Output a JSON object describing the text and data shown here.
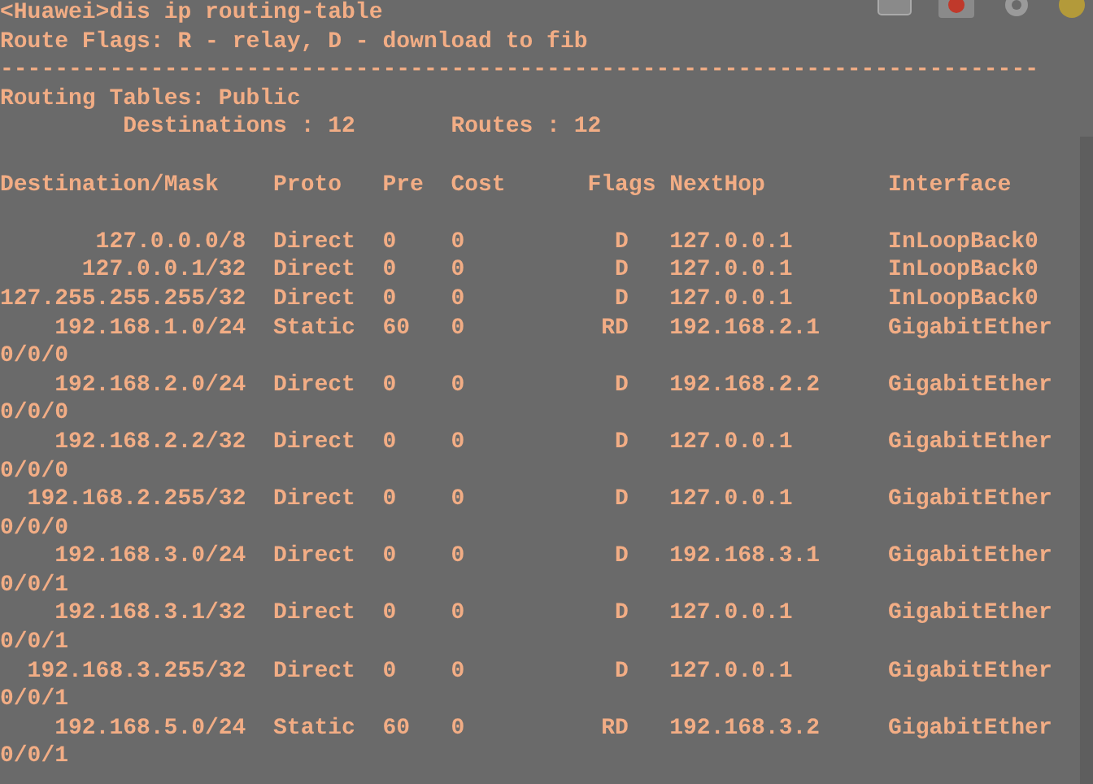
{
  "terminal": {
    "command": "<Huawei>dis ip routing-table",
    "flags_legend": "Route Flags: R - relay, D - download to fib",
    "rule": "----------------------------------------------------------------------------",
    "table_title": "Routing Tables: Public",
    "summary": [
      {
        "label": "Destinations : 12"
      },
      {
        "label": "Routes : 12"
      }
    ],
    "columns": [
      "Destination/Mask",
      "Proto",
      "Pre",
      "Cost",
      "Flags",
      "NextHop",
      "Interface"
    ],
    "rows": [
      {
        "cells": [
          "127.0.0.0/8",
          "Direct",
          "0",
          "0",
          "D",
          "127.0.0.1",
          "InLoopBack0"
        ]
      },
      {
        "cells": [
          "127.0.0.1/32",
          "Direct",
          "0",
          "0",
          "D",
          "127.0.0.1",
          "InLoopBack0"
        ]
      },
      {
        "cells": [
          "127.255.255.255/32",
          "Direct",
          "0",
          "0",
          "D",
          "127.0.0.1",
          "InLoopBack0"
        ]
      },
      {
        "cells": [
          "192.168.1.0/24",
          "Static",
          "60",
          "0",
          "RD",
          "192.168.2.1",
          "GigabitEther"
        ],
        "wrap": "0/0/0"
      },
      {
        "cells": [
          "192.168.2.0/24",
          "Direct",
          "0",
          "0",
          "D",
          "192.168.2.2",
          "GigabitEther"
        ],
        "wrap": "0/0/0"
      },
      {
        "cells": [
          "192.168.2.2/32",
          "Direct",
          "0",
          "0",
          "D",
          "127.0.0.1",
          "GigabitEther"
        ],
        "wrap": "0/0/0"
      },
      {
        "cells": [
          "192.168.2.255/32",
          "Direct",
          "0",
          "0",
          "D",
          "127.0.0.1",
          "GigabitEther"
        ],
        "wrap": "0/0/0"
      },
      {
        "cells": [
          "192.168.3.0/24",
          "Direct",
          "0",
          "0",
          "D",
          "192.168.3.1",
          "GigabitEther"
        ],
        "wrap": "0/0/1"
      },
      {
        "cells": [
          "192.168.3.1/32",
          "Direct",
          "0",
          "0",
          "D",
          "127.0.0.1",
          "GigabitEther"
        ],
        "wrap": "0/0/1"
      },
      {
        "cells": [
          "192.168.3.255/32",
          "Direct",
          "0",
          "0",
          "D",
          "127.0.0.1",
          "GigabitEther"
        ],
        "wrap": "0/0/1"
      },
      {
        "cells": [
          "192.168.5.0/24",
          "Static",
          "60",
          "0",
          "RD",
          "192.168.3.2",
          "GigabitEther"
        ],
        "wrap": "0/0/1"
      }
    ]
  }
}
